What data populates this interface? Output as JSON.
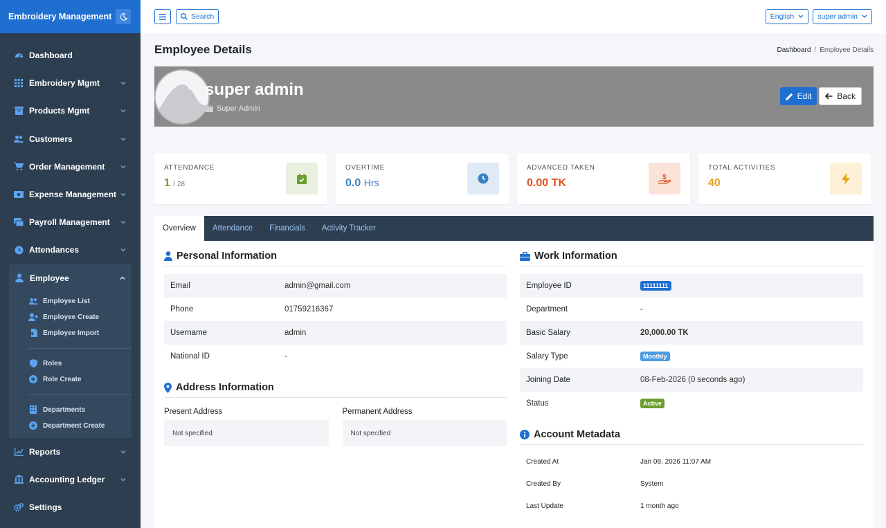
{
  "brand": {
    "title": "Embroidery Management"
  },
  "sidebar": {
    "items": [
      {
        "label": "Dashboard"
      },
      {
        "label": "Embroidery Mgmt"
      },
      {
        "label": "Products Mgmt"
      },
      {
        "label": "Customers"
      },
      {
        "label": "Order Management"
      },
      {
        "label": "Expense Management"
      },
      {
        "label": "Payroll Management"
      },
      {
        "label": "Attendances"
      },
      {
        "label": "Employee"
      },
      {
        "label": "Reports"
      },
      {
        "label": "Accounting Ledger"
      },
      {
        "label": "Settings"
      }
    ],
    "employee_sub": [
      {
        "label": "Employee List"
      },
      {
        "label": "Employee Create"
      },
      {
        "label": "Employee Import"
      },
      {
        "label": "Roles"
      },
      {
        "label": "Role Create"
      },
      {
        "label": "Departments"
      },
      {
        "label": "Department Create"
      }
    ]
  },
  "topbar": {
    "search_label": "Search",
    "language": "English",
    "user": "super admin"
  },
  "page": {
    "title": "Employee Details",
    "breadcrumb": [
      "Dashboard",
      "Employee Details"
    ]
  },
  "profile": {
    "name": "super admin",
    "role": "Super Admin",
    "edit_label": "Edit",
    "back_label": "Back"
  },
  "stats": {
    "attendance": {
      "label": "ATTENDANCE",
      "value": "1",
      "total": "/ 28",
      "color": "#6c9e2f"
    },
    "overtime": {
      "label": "OVERTIME",
      "value": "0.0",
      "unit": "Hrs",
      "color": "#3b82c4"
    },
    "advanced": {
      "label": "ADVANCED TAKEN",
      "value": "0.00 TK",
      "color": "#e0521f"
    },
    "activities": {
      "label": "TOTAL ACTIVITIES",
      "value": "40",
      "color": "#e6a316"
    }
  },
  "tabs": [
    {
      "label": "Overview"
    },
    {
      "label": "Attendance"
    },
    {
      "label": "Financials"
    },
    {
      "label": "Activity Tracker"
    }
  ],
  "personal": {
    "heading": "Personal Information",
    "rows": [
      {
        "k": "Email",
        "v": "admin@gmail.com"
      },
      {
        "k": "Phone",
        "v": "01759216367"
      },
      {
        "k": "Username",
        "v": "admin"
      },
      {
        "k": "National ID",
        "v": "-"
      }
    ]
  },
  "address": {
    "heading": "Address Information",
    "present_label": "Present Address",
    "present_value": "Not specified",
    "permanent_label": "Permanent Address",
    "permanent_value": "Not specified"
  },
  "work": {
    "heading": "Work Information",
    "employee_id_label": "Employee ID",
    "employee_id": "11111111",
    "department_label": "Department",
    "department": "-",
    "salary_label": "Basic Salary",
    "salary": "20,000.00 TK",
    "salary_type_label": "Salary Type",
    "salary_type": "Monthly",
    "joining_label": "Joining Date",
    "joining": "08-Feb-2026 (0 seconds ago)",
    "status_label": "Status",
    "status": "Active"
  },
  "metadata": {
    "heading": "Account Metadata",
    "rows": [
      {
        "k": "Created At",
        "v": "Jan 08, 2026 11:07 AM"
      },
      {
        "k": "Created By",
        "v": "System"
      },
      {
        "k": "Last Update",
        "v": "1 month ago"
      }
    ]
  }
}
